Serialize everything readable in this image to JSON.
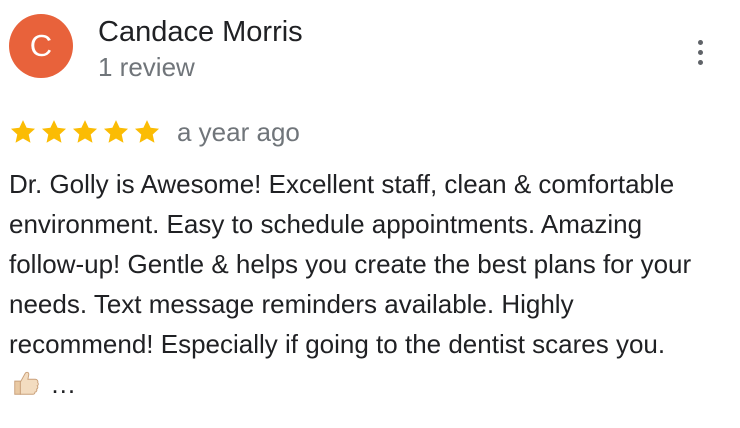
{
  "reviewer": {
    "initial": "C",
    "name": "Candace Morris",
    "review_count": "1 review",
    "avatar_color": "#e8623b"
  },
  "review": {
    "rating": 5,
    "max_rating": 5,
    "star_color": "#fbbc04",
    "time_ago": "a year ago",
    "text_before_emoji": "Dr. Golly is Awesome! Excellent staff, clean & comfortable environment. Easy to schedule appointments. Amazing follow-up! Gentle & helps you create the best plans for your needs. Text message reminders available. Highly recommend! Especially if going to the dentist scares you.",
    "emoji": "thumbs-up",
    "ellipsis": "…"
  },
  "actions": {
    "more_icon": "more-vert-icon"
  }
}
